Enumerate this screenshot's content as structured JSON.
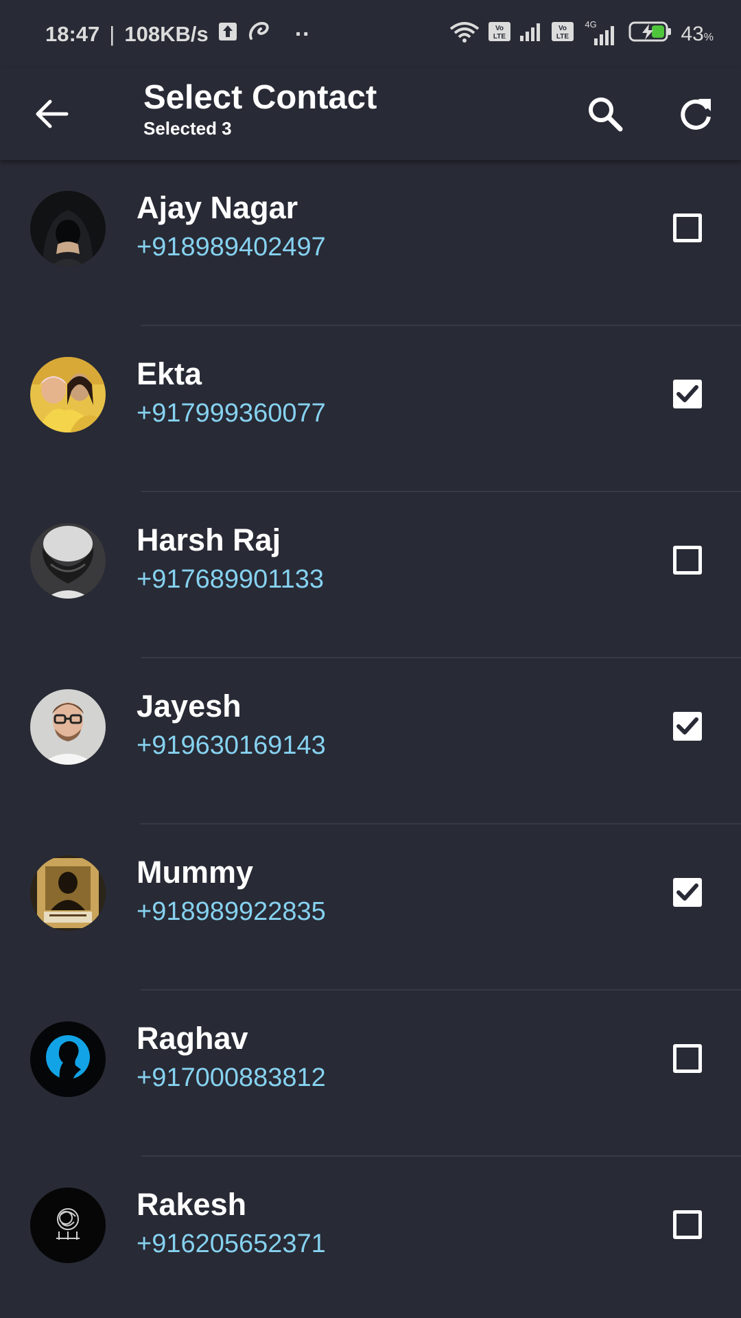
{
  "status_bar": {
    "time": "18:47",
    "separator": "|",
    "speed": "108KB/s",
    "dots": "··",
    "volte_label": "Vo\nLTE",
    "network_4g": "4G",
    "battery_percent": "43",
    "percent_sign": "%"
  },
  "toolbar": {
    "title": "Select Contact",
    "subtitle": "Selected 3",
    "icons": {
      "back": "arrow-back-icon",
      "search": "search-icon",
      "refresh": "refresh-icon"
    }
  },
  "colors": {
    "background": "#282a35",
    "phone_text": "#86d2f0",
    "divider": "#373a46",
    "checkbox": "#ffffff"
  },
  "contacts": [
    {
      "name": "Ajay Nagar",
      "phone": "+918989402497",
      "checked": false,
      "avatar": "hooded-figure-avatar"
    },
    {
      "name": "Ekta",
      "phone": "+917999360077",
      "checked": true,
      "avatar": "mother-child-avatar"
    },
    {
      "name": "Harsh Raj",
      "phone": "+917689901133",
      "checked": false,
      "avatar": "bearded-man-avatar"
    },
    {
      "name": "Jayesh",
      "phone": "+919630169143",
      "checked": true,
      "avatar": "man-glasses-avatar"
    },
    {
      "name": "Mummy",
      "phone": "+918989922835",
      "checked": true,
      "avatar": "golden-deity-avatar"
    },
    {
      "name": "Raghav",
      "phone": "+917000883812",
      "checked": false,
      "avatar": "blue-silhouette-avatar"
    },
    {
      "name": "Rakesh",
      "phone": "+916205652371",
      "checked": false,
      "avatar": "sketch-avatar"
    }
  ]
}
